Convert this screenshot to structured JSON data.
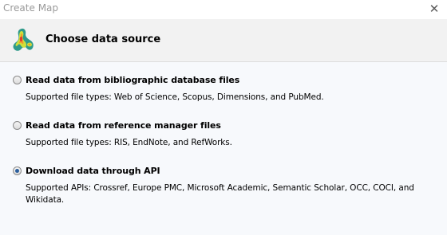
{
  "window": {
    "title": "Create Map",
    "close_label": "✕"
  },
  "header": {
    "title": "Choose data source",
    "icon": "vosviewer-density-map-icon"
  },
  "options": [
    {
      "label": "Read data from bibliographic database files",
      "description": "Supported file types: Web of Science, Scopus, Dimensions, and PubMed.",
      "selected": false
    },
    {
      "label": "Read data from reference manager files",
      "description": "Supported file types: RIS, EndNote, and RefWorks.",
      "selected": false
    },
    {
      "label": "Download data through API",
      "description": "Supported APIs: Crossref, Europe PMC, Microsoft Academic, Semantic Scholar, OCC, COCI, and Wikidata.",
      "selected": true
    }
  ],
  "colors": {
    "header_bg": "#f2f2f2",
    "content_bg": "#f7f9fc",
    "radio_dot": "#2b5f9e"
  }
}
